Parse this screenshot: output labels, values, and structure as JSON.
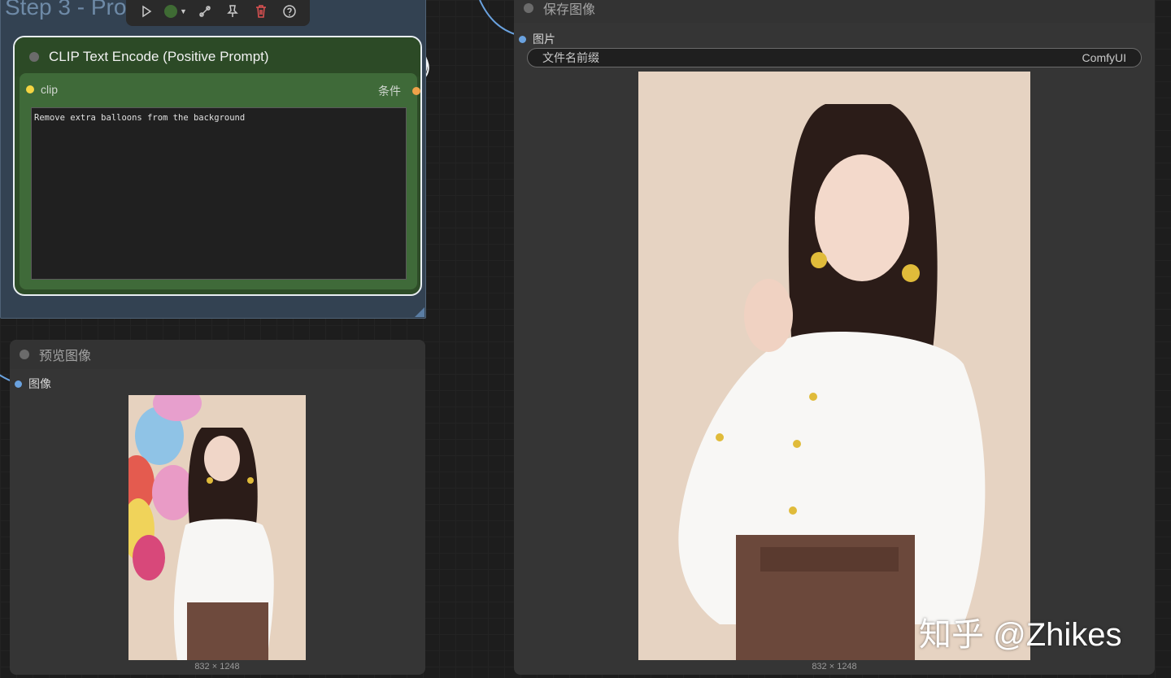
{
  "group": {
    "title": "Step 3 - Pro"
  },
  "toolbar": {
    "icons": [
      "play-icon",
      "color-swatch",
      "bypass-icon",
      "pin-icon",
      "trash-icon",
      "help-icon"
    ],
    "swatch_color": "#3f6b34",
    "trash_color": "#e05252"
  },
  "clip_node": {
    "title": "CLIP Text Encode (Positive Prompt)",
    "input_label": "clip",
    "output_label": "条件",
    "prompt_text": "Remove extra balloons from the background",
    "input_pin_color": "#f5d442",
    "output_pin_color": "#f0a24a"
  },
  "preview_node": {
    "title": "预览图像",
    "input_label": "图像",
    "image_size": "832 × 1248"
  },
  "save_node": {
    "title": "保存图像",
    "input_label": "图片",
    "prefix_label": "文件名前缀",
    "prefix_value": "ComfyUI",
    "image_size": "832 × 1248"
  },
  "watermark": "知乎 @Zhikes"
}
